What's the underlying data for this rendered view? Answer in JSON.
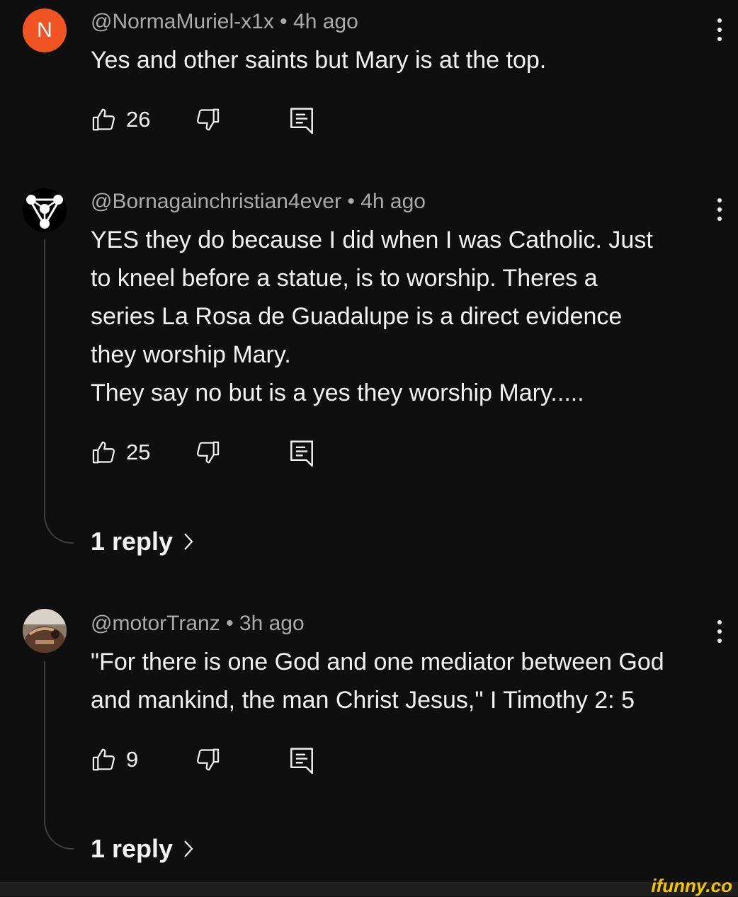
{
  "comments": [
    {
      "avatar_letter": "N",
      "author": "@NormaMuriel-x1x",
      "time": "4h ago",
      "text": "Yes and other saints but Mary is at the top.",
      "likes": "26"
    },
    {
      "author": "@Bornagainchristian4ever",
      "time": "4h ago",
      "text": "YES they do because I did when I was Catholic. Just\nto kneel before a statue, is to worship.  Theres a\nseries La Rosa de Guadalupe is a direct evidence\nthey worship Mary.\nThey say no but is a yes they worship Mary.....",
      "likes": "25",
      "replies": "1 reply"
    },
    {
      "author": "@motorTranz",
      "time": "3h ago",
      "text": "\"For there is one God and one mediator between God\nand mankind, the man Christ Jesus,\" I Timothy 2: 5",
      "likes": "9",
      "replies": "1 reply"
    }
  ],
  "separator": "•",
  "watermark": "ifunny.co",
  "colors": {
    "background": "#0f0f0f",
    "meta": "#aaaaaa",
    "avatar_n": "#ef5422",
    "watermark": "#f3c400"
  }
}
